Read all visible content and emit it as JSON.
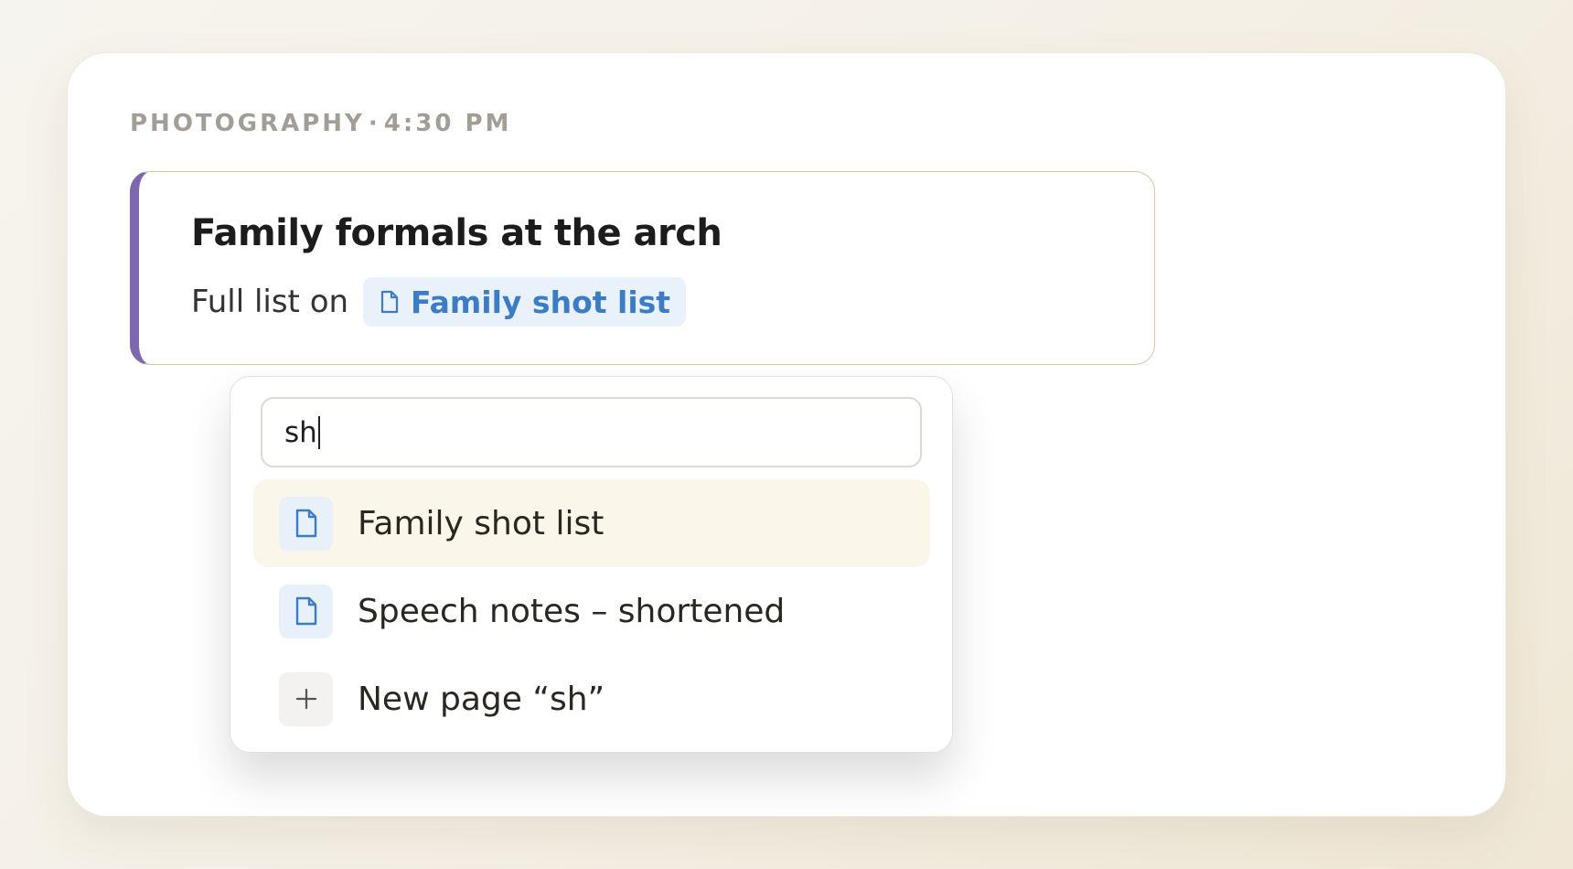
{
  "header": {
    "category": "PHOTOGRAPHY",
    "separator": "·",
    "time": "4:30 PM"
  },
  "block": {
    "title": "Family formals at the arch",
    "prefix": "Full list on",
    "link_label": "Family shot list",
    "link_icon": "document-icon",
    "accent_color": "#7d67ad",
    "link_color": "#3b7cc4"
  },
  "popup": {
    "query": "sh",
    "items": [
      {
        "label": "Family shot list",
        "icon": "document-icon",
        "selected": true
      },
      {
        "label": "Speech notes – shortened",
        "icon": "document-icon",
        "selected": false
      },
      {
        "label": "New page “sh”",
        "icon": "plus-icon",
        "selected": false
      }
    ]
  }
}
